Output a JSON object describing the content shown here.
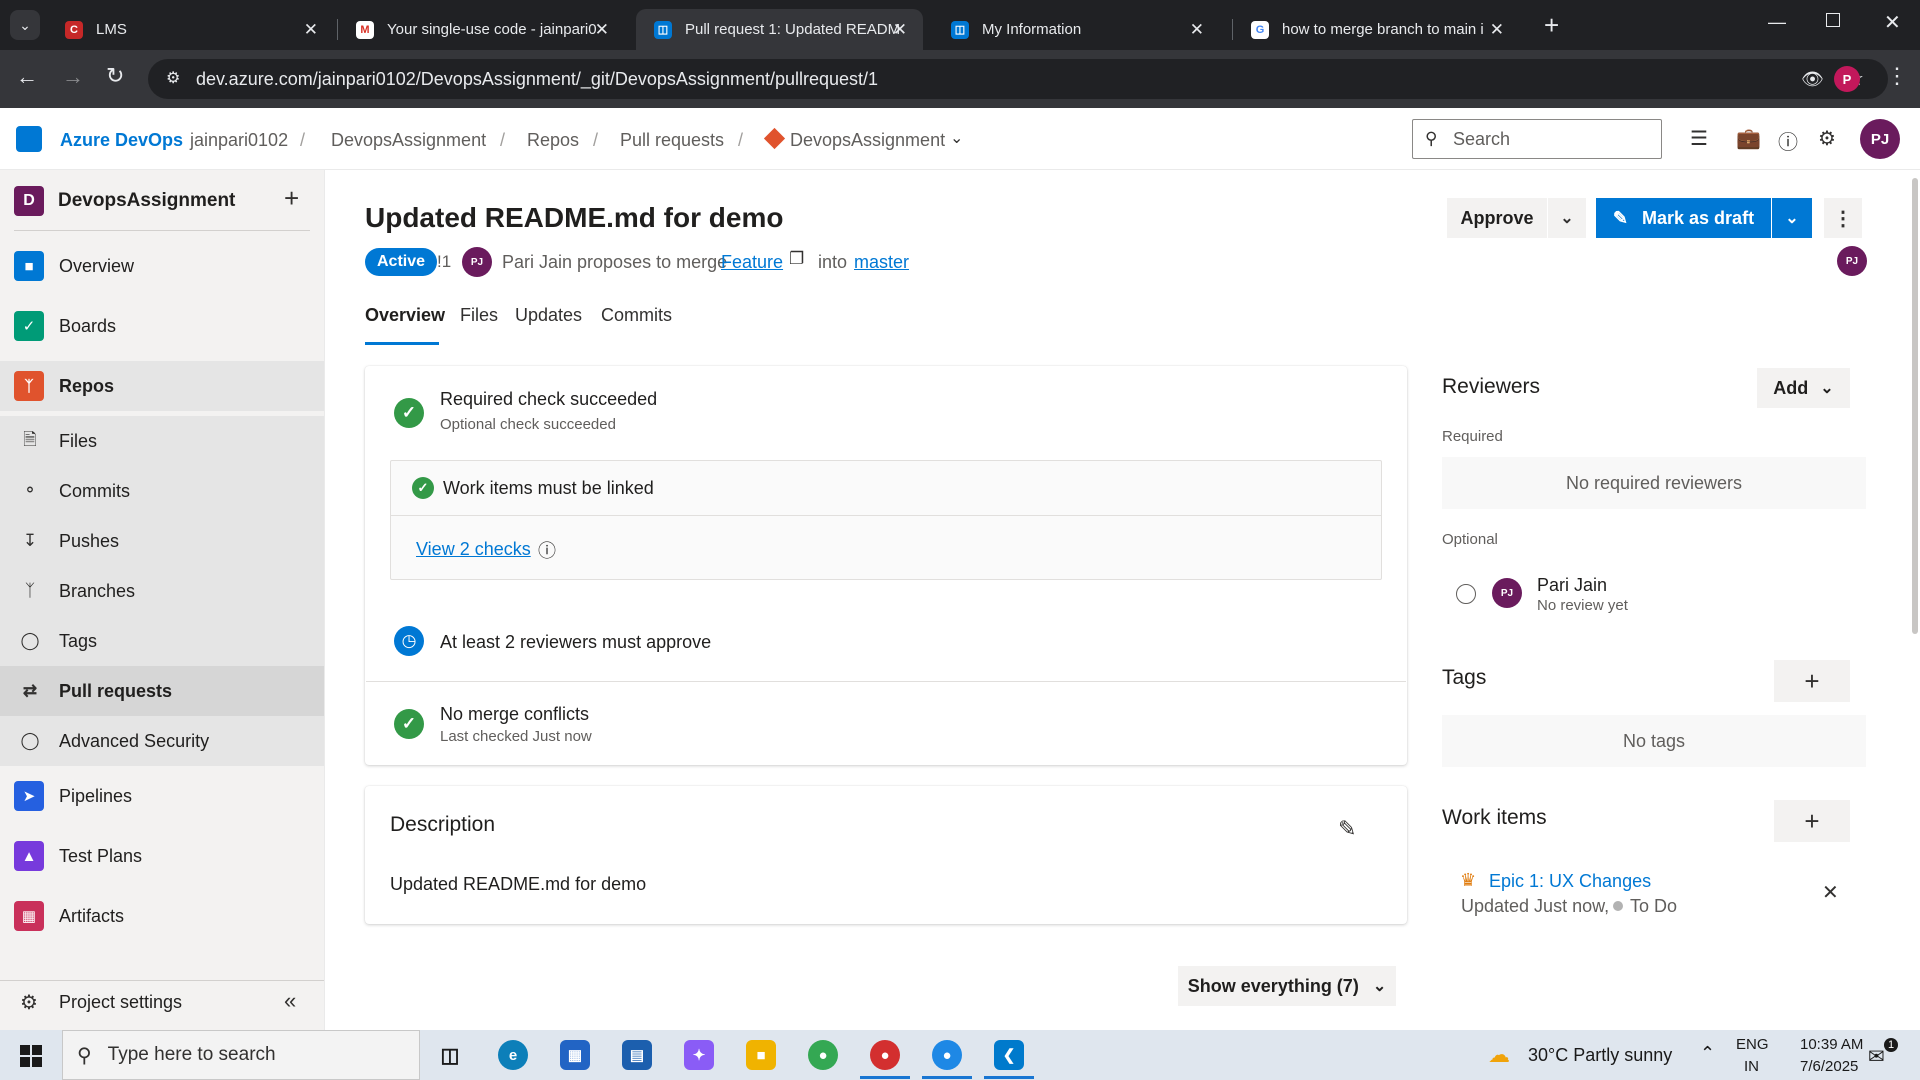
{
  "browser": {
    "tabs": [
      {
        "title": "LMS",
        "icon": "lms-icon"
      },
      {
        "title": "Your single-use code - jainpari0",
        "icon": "gmail-icon"
      },
      {
        "title": "Pull request 1: Updated READM",
        "icon": "azure-devops-icon"
      },
      {
        "title": "My Information",
        "icon": "azure-devops-icon"
      },
      {
        "title": "how to merge branch to main i",
        "icon": "google-icon"
      }
    ],
    "url": "dev.azure.com/jainpari0102/DevopsAssignment/_git/DevopsAssignment/pullrequest/1",
    "profile_initial": "P"
  },
  "header": {
    "product": "Azure DevOps",
    "org": "jainpari0102",
    "breadcrumbs": [
      "DevopsAssignment",
      "Repos",
      "Pull requests",
      "DevopsAssignment"
    ],
    "search_placeholder": "Search",
    "user_initials": "PJ"
  },
  "sidebar": {
    "project_initial": "D",
    "project_name": "DevopsAssignment",
    "items": [
      {
        "label": "Overview"
      },
      {
        "label": "Boards"
      },
      {
        "label": "Repos"
      },
      {
        "label": "Files"
      },
      {
        "label": "Commits"
      },
      {
        "label": "Pushes"
      },
      {
        "label": "Branches"
      },
      {
        "label": "Tags"
      },
      {
        "label": "Pull requests"
      },
      {
        "label": "Advanced Security"
      },
      {
        "label": "Pipelines"
      },
      {
        "label": "Test Plans"
      },
      {
        "label": "Artifacts"
      }
    ],
    "settings_label": "Project settings"
  },
  "pr": {
    "title": "Updated README.md for demo",
    "status": "Active",
    "id": "!1",
    "author_initials": "PJ",
    "proposal_text": "Pari Jain proposes to merge",
    "source_branch": "Feature",
    "into_text": "into",
    "target_branch": "master",
    "approve_label": "Approve",
    "draft_label": "Mark as draft",
    "tabs": [
      "Overview",
      "Files",
      "Updates",
      "Commits"
    ]
  },
  "checks": {
    "required_title": "Required check succeeded",
    "required_sub": "Optional check succeeded",
    "work_items_title": "Work items must be linked",
    "view_checks": "View 2 checks",
    "reviewers_policy": "At least 2 reviewers must approve",
    "merge_title": "No merge conflicts",
    "merge_sub": "Last checked Just now"
  },
  "description": {
    "heading": "Description",
    "body": "Updated README.md for demo"
  },
  "show_everything": "Show everything (7)",
  "reviewers": {
    "heading": "Reviewers",
    "add_label": "Add",
    "required_label": "Required",
    "required_empty": "No required reviewers",
    "optional_label": "Optional",
    "reviewer_name": "Pari Jain",
    "reviewer_status": "No review yet",
    "reviewer_initials": "PJ"
  },
  "tags": {
    "heading": "Tags",
    "empty": "No tags"
  },
  "work_items": {
    "heading": "Work items",
    "item_title": "Epic 1: UX Changes",
    "item_updated": "Updated Just now,",
    "item_state": "To Do"
  },
  "taskbar": {
    "search_placeholder": "Type here to search",
    "weather": "30°C  Partly sunny",
    "lang_top": "ENG",
    "lang_bottom": "IN",
    "time": "10:39 AM",
    "date": "7/6/2025",
    "notification_count": "1"
  },
  "colors": {
    "accent": "#0078d4",
    "success": "#339947",
    "avatar": "#6a1b5d"
  }
}
